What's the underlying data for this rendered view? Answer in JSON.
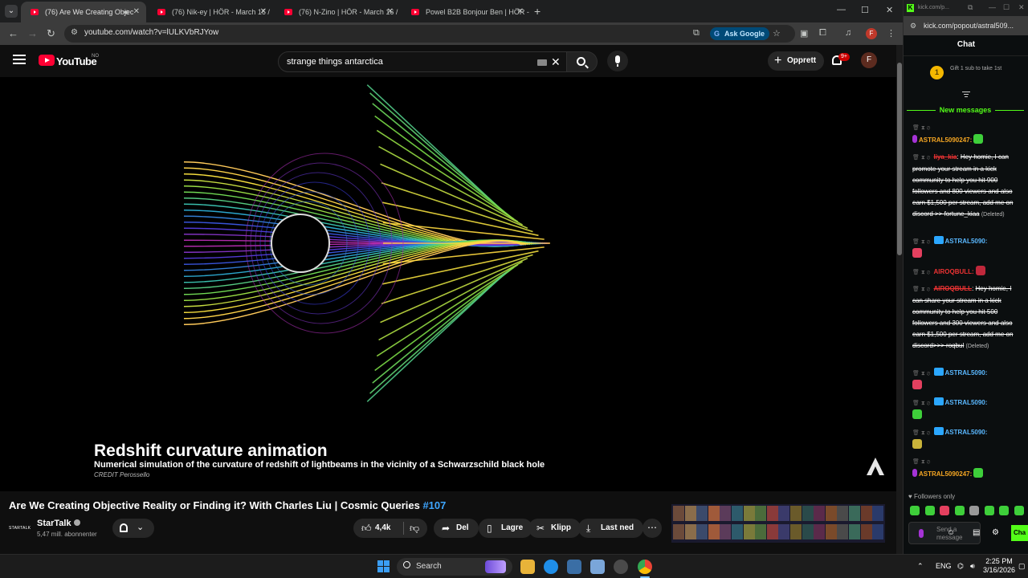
{
  "browser": {
    "tabs": [
      {
        "title": "(76) Are We Creating Objec",
        "active": true
      },
      {
        "title": "(76) Nik-ey | HÖR - March 16 /"
      },
      {
        "title": "(76) N-Zino | HÖR - March 16 /"
      },
      {
        "title": "Powel B2B Bonjour Ben | HÖR -"
      }
    ],
    "url": "youtube.com/watch?v=lULKVbRJYow",
    "ask_google": "Ask Google",
    "profile_initial": "F"
  },
  "youtube": {
    "logo_text": "YouTube",
    "country_code": "NO",
    "search_query": "strange things antarctica",
    "create_label": "Opprett",
    "notification_count": "9+",
    "avatar_initial": "F",
    "video": {
      "overlay_title": "Redshift curvature animation",
      "overlay_subtitle": "Numerical simulation of the curvature of redshift of lightbeams in the vicinity of a Schwarzschild black hole",
      "overlay_credit": "CREDIT Perossello",
      "title": "Are We Creating Objective Reality or Finding it? With Charles Liu | Cosmic Queries",
      "hashtag": "#107"
    },
    "channel": {
      "logo_text": "STARTALK",
      "name": "StarTalk",
      "subscribers": "5,47 mill. abonnenter"
    },
    "actions": {
      "likes": "4,4k",
      "share": "Del",
      "save": "Lagre",
      "clip": "Klipp",
      "download": "Last ned"
    }
  },
  "kick": {
    "window_url": "kick.com/p...",
    "url": "kick.com/popout/astral509...",
    "header": "Chat",
    "gift_text": "Gift 1 sub to take 1st",
    "new_messages": "New messages",
    "messages": [
      {
        "user": "ASTRAL5090247:",
        "text": ""
      },
      {
        "user": "liya_kia",
        "text": "Hey homie, I can promote your stream in a kick community to help you hit 900 followers and 800 viewers and also earn $1,500 per stream, add me on discord >> fortune_kiaa",
        "deleted": "(Deleted)"
      },
      {
        "user": "ASTRAL5090:",
        "text": ""
      },
      {
        "user": "AIROQBULL:",
        "text": ""
      },
      {
        "user": "AIROQBULL",
        "text": "Hey homie, I can share your stream in a kick community to help you hit 500 followers and 300 viewers and also earn $1,500 per stream, add me on discord>>> roqbul",
        "deleted": "(Deleted)"
      },
      {
        "user": "ASTRAL5090:",
        "text": ""
      },
      {
        "user": "ASTRAL5090:",
        "text": ""
      },
      {
        "user": "ASTRAL5090:",
        "text": ""
      },
      {
        "user": "ASTRAL5090247:",
        "text": ""
      }
    ],
    "followers_only": "Followers only",
    "input_placeholder": "Send a message",
    "chat_button": "Cha"
  },
  "taskbar": {
    "search": "Search",
    "lang": "ENG",
    "time": "2:25 PM",
    "date": "3/16/2026"
  },
  "colors": {
    "kick_green": "#53fc18",
    "yt_red": "#ff0033",
    "link_blue": "#3ea6ff"
  }
}
